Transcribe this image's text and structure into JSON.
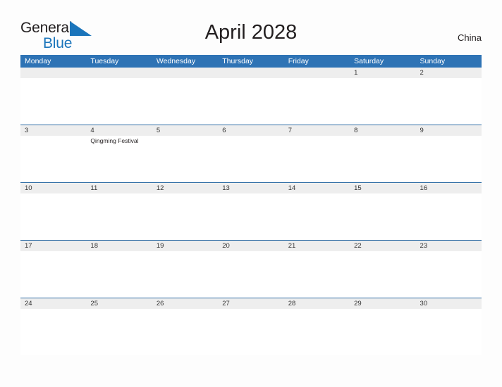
{
  "brand": {
    "name_part1": "General",
    "name_part2": "Blue",
    "flag_icon": "blue-triangle-flag-icon",
    "color_primary": "#1b75bb",
    "color_text": "#231f20"
  },
  "header": {
    "title": "April 2028",
    "country": "China"
  },
  "calendar": {
    "accent_color": "#2e73b5",
    "band_color": "#eeeeee",
    "separator_color": "#2e6ca4",
    "weekdays": [
      "Monday",
      "Tuesday",
      "Wednesday",
      "Thursday",
      "Friday",
      "Saturday",
      "Sunday"
    ],
    "weeks": [
      {
        "days": [
          {
            "date": "",
            "events": []
          },
          {
            "date": "",
            "events": []
          },
          {
            "date": "",
            "events": []
          },
          {
            "date": "",
            "events": []
          },
          {
            "date": "",
            "events": []
          },
          {
            "date": "1",
            "events": []
          },
          {
            "date": "2",
            "events": []
          }
        ]
      },
      {
        "days": [
          {
            "date": "3",
            "events": []
          },
          {
            "date": "4",
            "events": [
              "Qingming Festival"
            ]
          },
          {
            "date": "5",
            "events": []
          },
          {
            "date": "6",
            "events": []
          },
          {
            "date": "7",
            "events": []
          },
          {
            "date": "8",
            "events": []
          },
          {
            "date": "9",
            "events": []
          }
        ]
      },
      {
        "days": [
          {
            "date": "10",
            "events": []
          },
          {
            "date": "11",
            "events": []
          },
          {
            "date": "12",
            "events": []
          },
          {
            "date": "13",
            "events": []
          },
          {
            "date": "14",
            "events": []
          },
          {
            "date": "15",
            "events": []
          },
          {
            "date": "16",
            "events": []
          }
        ]
      },
      {
        "days": [
          {
            "date": "17",
            "events": []
          },
          {
            "date": "18",
            "events": []
          },
          {
            "date": "19",
            "events": []
          },
          {
            "date": "20",
            "events": []
          },
          {
            "date": "21",
            "events": []
          },
          {
            "date": "22",
            "events": []
          },
          {
            "date": "23",
            "events": []
          }
        ]
      },
      {
        "days": [
          {
            "date": "24",
            "events": []
          },
          {
            "date": "25",
            "events": []
          },
          {
            "date": "26",
            "events": []
          },
          {
            "date": "27",
            "events": []
          },
          {
            "date": "28",
            "events": []
          },
          {
            "date": "29",
            "events": []
          },
          {
            "date": "30",
            "events": []
          }
        ]
      }
    ]
  }
}
